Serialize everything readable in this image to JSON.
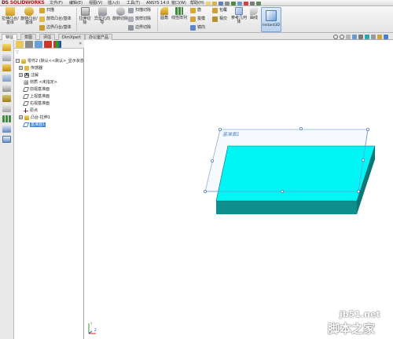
{
  "app": {
    "logo_text": "SOLIDWORKS",
    "logo_prefix": "DS"
  },
  "menu": [
    "文件(F)",
    "编辑(E)",
    "视图(V)",
    "插入(I)",
    "工具(T)",
    "ANSYS 14.0",
    "窗口(W)",
    "帮助(H)"
  ],
  "ribbon": {
    "extrude_boss": "拉伸凸台/基体",
    "revolve_boss": "旋转凸台/基体",
    "sweep": "扫描",
    "loft_boss": "放样凸台/基体",
    "boundary_boss": "边界凸台/基体",
    "extrude_cut": "拉伸切除",
    "hole_wizard": "异型孔向导",
    "revolve_cut": "旋转切除",
    "sweep_cut": "扫描切除",
    "loft_cut": "放样切除",
    "boundary_cut": "边界切除",
    "fillet": "圆角",
    "linear_pattern": "线性阵列",
    "rib": "筋",
    "draft": "拔模",
    "shell": "抽壳",
    "wrap": "包覆",
    "intersect": "相交",
    "mirror": "镜向",
    "reference_geometry": "参考几何体",
    "curves": "曲线",
    "instant3d": "Instant3D"
  },
  "tabs": [
    "特征",
    "草图",
    "评估",
    "DimXpert",
    "办公室产品"
  ],
  "feature_tree": {
    "filter_glyph": "▽",
    "collapse_glyph": "»",
    "root": "零件2 (默认<<默认>_显示状态",
    "items": [
      {
        "label": "传感器",
        "icon": "sensor-icon"
      },
      {
        "label": "注解",
        "icon": "annotation-icon"
      },
      {
        "label": "材质 <未指定>",
        "icon": "material-icon"
      },
      {
        "label": "前视基准面",
        "icon": "plane-icon"
      },
      {
        "label": "上视基准面",
        "icon": "plane-icon"
      },
      {
        "label": "右视基准面",
        "icon": "plane-icon"
      },
      {
        "label": "原点",
        "icon": "origin-icon"
      },
      {
        "label": "凸台-拉伸1",
        "icon": "extrude-icon"
      },
      {
        "label": "基准面1",
        "icon": "plane-icon",
        "selected": true
      }
    ]
  },
  "viewport": {
    "plane_label": "基准面1",
    "body_color": "#00f5f5"
  },
  "watermark": {
    "site": "jb51.net",
    "name": "脚本之家"
  }
}
